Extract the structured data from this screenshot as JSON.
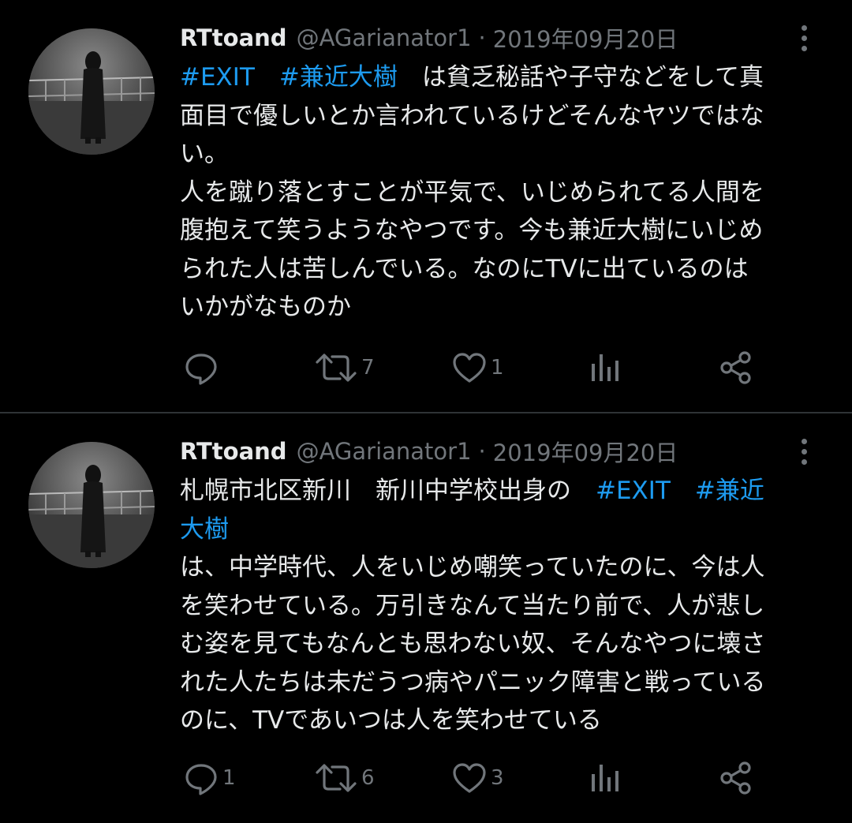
{
  "colors": {
    "background": "#000000",
    "text": "#e7e9ea",
    "secondary": "#71767b",
    "hashtag": "#1d9bf0",
    "divider": "#2f3336"
  },
  "tweets": [
    {
      "display_name": "RTtoand",
      "handle": "@AGarianator1",
      "separator": "·",
      "date": "2019年09月20日",
      "lines": [
        [
          {
            "text": "#EXIT",
            "type": "hashtag"
          },
          {
            "text": "　",
            "type": "text"
          },
          {
            "text": "#兼近大樹",
            "type": "hashtag"
          },
          {
            "text": "　は貧乏秘話や子守などをして真",
            "type": "text"
          }
        ],
        [
          {
            "text": "面目で優しいとか言われているけどそんなヤツではな",
            "type": "text"
          }
        ],
        [
          {
            "text": "い。",
            "type": "text"
          }
        ],
        [
          {
            "text": "人を蹴り落とすことが平気で、いじめられてる人間を",
            "type": "text"
          }
        ],
        [
          {
            "text": "腹抱えて笑うようなやつです。今も兼近大樹にいじめ",
            "type": "text"
          }
        ],
        [
          {
            "text": "られた人は苦しんでいる。なのにTVに出ているのは",
            "type": "text"
          }
        ],
        [
          {
            "text": "いかがなものか",
            "type": "text"
          }
        ]
      ],
      "actions": {
        "reply_icon": "reply-icon",
        "reply_count": "",
        "retweet_icon": "retweet-icon",
        "retweet_count": "7",
        "like_icon": "heart-icon",
        "like_count": "1",
        "views_icon": "analytics-icon",
        "share_icon": "share-icon"
      }
    },
    {
      "display_name": "RTtoand",
      "handle": "@AGarianator1",
      "separator": "·",
      "date": "2019年09月20日",
      "lines": [
        [
          {
            "text": "札幌市北区新川　新川中学校出身の　",
            "type": "text"
          },
          {
            "text": "#EXIT",
            "type": "hashtag"
          },
          {
            "text": "　",
            "type": "text"
          },
          {
            "text": "#兼近",
            "type": "hashtag"
          }
        ],
        [
          {
            "text": "大樹",
            "type": "hashtag"
          }
        ],
        [
          {
            "text": "は、中学時代、人をいじめ嘲笑っていたのに、今は人",
            "type": "text"
          }
        ],
        [
          {
            "text": "を笑わせている。万引きなんて当たり前で、人が悲し",
            "type": "text"
          }
        ],
        [
          {
            "text": "む姿を見てもなんとも思わない奴、そんなやつに壊さ",
            "type": "text"
          }
        ],
        [
          {
            "text": "れた人たちは未だうつ病やパニック障害と戦っている",
            "type": "text"
          }
        ],
        [
          {
            "text": "のに、TVであいつは人を笑わせている",
            "type": "text"
          }
        ]
      ],
      "actions": {
        "reply_icon": "reply-icon",
        "reply_count": "1",
        "retweet_icon": "retweet-icon",
        "retweet_count": "6",
        "like_icon": "heart-icon",
        "like_count": "3",
        "views_icon": "analytics-icon",
        "share_icon": "share-icon"
      }
    }
  ]
}
